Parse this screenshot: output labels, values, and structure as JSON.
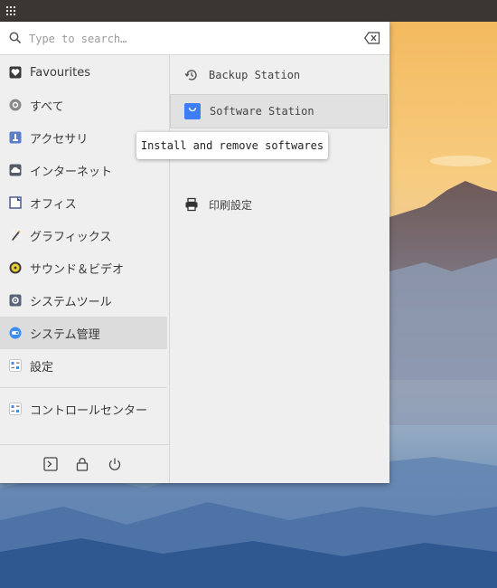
{
  "search": {
    "placeholder": "Type to search…"
  },
  "categories": [
    {
      "label": "Favourites",
      "icon": "heart-icon"
    },
    {
      "label": "すべて",
      "icon": "all-apps-icon"
    },
    {
      "label": "アクセサリ",
      "icon": "accessories-icon"
    },
    {
      "label": "インターネット",
      "icon": "internet-cloud-icon"
    },
    {
      "label": "オフィス",
      "icon": "office-icon"
    },
    {
      "label": "グラフィックス",
      "icon": "graphics-icon"
    },
    {
      "label": "サウンド＆ビデオ",
      "icon": "sound-video-icon"
    },
    {
      "label": "システムツール",
      "icon": "system-tools-icon"
    },
    {
      "label": "システム管理",
      "icon": "system-admin-icon",
      "selected": true
    },
    {
      "label": "設定",
      "icon": "settings-icon"
    },
    {
      "label": "コントロールセンター",
      "icon": "control-center-icon"
    }
  ],
  "apps": [
    {
      "label": "Backup Station",
      "icon": "backup-history-icon"
    },
    {
      "label": "Software Station",
      "icon": "software-bag-icon",
      "highlighted": true
    },
    {
      "label": "",
      "icon": "hidden-app-icon"
    },
    {
      "label": "印刷設定",
      "icon": "printer-icon"
    }
  ],
  "tooltip": {
    "text": "Install and remove softwares"
  },
  "footer": {
    "icons": [
      "terminal-icon",
      "lock-icon",
      "power-icon"
    ]
  },
  "colors": {
    "panel": "#3b3632",
    "menu_bg": "#efefef",
    "selected_bg": "#dcdcdc",
    "accent_blue": "#3d7ef5",
    "wallpaper_sky_top": "#f6c46e",
    "wallpaper_mountains": "#3a6ba3"
  }
}
